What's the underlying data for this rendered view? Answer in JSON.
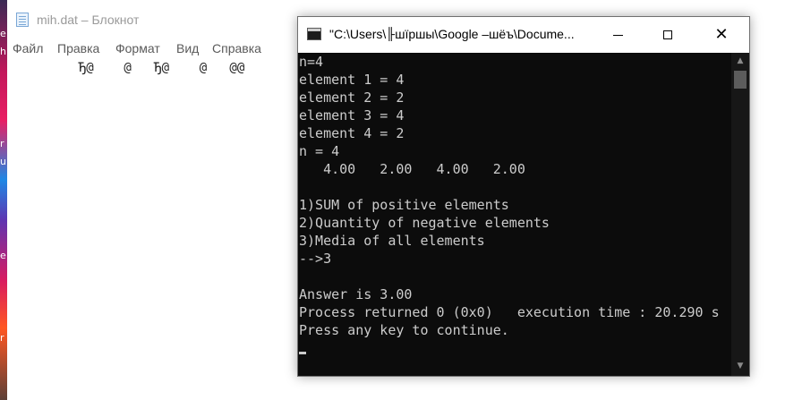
{
  "desktop": {
    "fragments": [
      "e",
      "h",
      "r",
      "ui",
      "e",
      "r"
    ]
  },
  "notepad": {
    "title": "mih.dat – Блокнот",
    "menu": [
      "Файл",
      "Правка",
      "Формат",
      "Вид",
      "Справка"
    ],
    "content": "         Ђ@    @   Ђ@    @   @@"
  },
  "console": {
    "title": "\"C:\\Users\\╟шїршы\\Google –шёъ\\Docume...",
    "lines": [
      "n=4",
      "element 1 = 4",
      "element 2 = 2",
      "element 3 = 4",
      "element 4 = 2",
      "n = 4",
      "   4.00   2.00   4.00   2.00",
      "",
      "1)SUM of positive elements",
      "2)Quantity of negative elements",
      "3)Media of all elements",
      "-->3",
      "",
      "Answer is 3.00",
      "Process returned 0 (0x0)   execution time : 20.290 s",
      "Press any key to continue."
    ]
  },
  "colors": {
    "console_bg": "#0c0c0c",
    "console_text": "#cccccc",
    "notepad_bg": "#ffffff"
  }
}
